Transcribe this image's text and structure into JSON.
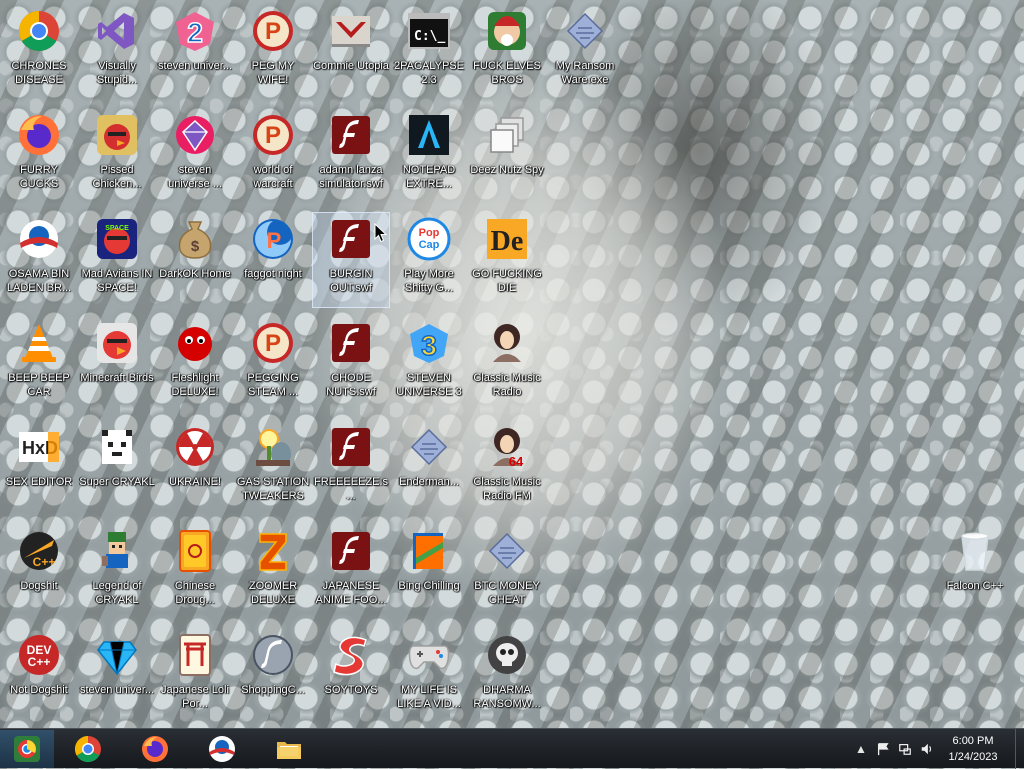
{
  "desktop": {
    "icons": [
      {
        "label": "CHRONES DISEASE",
        "icon": "chrome-icon"
      },
      {
        "label": "Visually Stupid...",
        "icon": "visual-studio-icon"
      },
      {
        "label": "steven univer...",
        "icon": "steven-universe-2-icon"
      },
      {
        "label": "PEG MY WIFE!",
        "icon": "popcap-peggle-icon"
      },
      {
        "label": "Commie Utopia",
        "icon": "papers-please-icon"
      },
      {
        "label": "2PACALYPSE 2.3",
        "icon": "command-prompt-icon"
      },
      {
        "label": "FUCK ELVES BROS",
        "icon": "elf-bros-icon"
      },
      {
        "label": "My Ransom Ware.exe",
        "icon": "diamond-executable-icon"
      },
      {
        "label": "FURRY CUCKS",
        "icon": "firefox-icon"
      },
      {
        "label": "Pissed Chicken...",
        "icon": "angry-birds-seasons-icon"
      },
      {
        "label": "steven universe ...",
        "icon": "steven-universe-gem-icon"
      },
      {
        "label": "world of warcraft",
        "icon": "popcap-peggle-icon"
      },
      {
        "label": "adamn lanza simulator.swf",
        "icon": "flash-file-icon"
      },
      {
        "label": "NOTEPAD EXTRE...",
        "icon": "notepad-extreme-icon"
      },
      {
        "label": "Deez Nutz Spy",
        "icon": "stacked-windows-icon"
      },
      {
        "label": "OSAMA BIN LADEN BR...",
        "icon": "obama-logo-icon"
      },
      {
        "label": "Mad Avians IN SPACE!",
        "icon": "angry-birds-space-icon"
      },
      {
        "label": "DarkOK Home",
        "icon": "money-bag-icon"
      },
      {
        "label": "faggot night",
        "icon": "popcap-peggle-nights-icon"
      },
      {
        "label": "BURGIN OUT.swf",
        "icon": "flash-file-icon"
      },
      {
        "label": "Play More Shitty G...",
        "icon": "popcap-icon"
      },
      {
        "label": "GO FUCKING DIE",
        "icon": "de-logo-icon"
      },
      {
        "label": "BEEP BEEP CAR",
        "icon": "vlc-icon"
      },
      {
        "label": "Minecraft Birds",
        "icon": "angry-birds-icon"
      },
      {
        "label": "Fleshlight DELUXE!",
        "icon": "red-fuzzball-icon"
      },
      {
        "label": "PEGGING STEAM ...",
        "icon": "popcap-peggle-icon"
      },
      {
        "label": "CHODE NUTS.swf",
        "icon": "flash-file-icon"
      },
      {
        "label": "STEVEN UNIVERSE 3",
        "icon": "steven-universe-3-icon"
      },
      {
        "label": "Classic Music Radio",
        "icon": "classic-portrait-icon"
      },
      {
        "label": "SEX EDITOR",
        "icon": "hxd-hex-editor-icon"
      },
      {
        "label": "Super CRYAKL",
        "icon": "pixel-cat-icon"
      },
      {
        "label": "UKRAINE!",
        "icon": "radiation-icon"
      },
      {
        "label": "GAS STATION TWEAKERS",
        "icon": "plants-vs-zombies-icon"
      },
      {
        "label": "FREEEEEZE.s...",
        "icon": "flash-file-icon"
      },
      {
        "label": "Enderman...",
        "icon": "diamond-executable-icon"
      },
      {
        "label": "Classic Music Radio FM",
        "icon": "classic-portrait-64-icon"
      },
      {
        "label": "Dogshit",
        "icon": "code-blocks-icon"
      },
      {
        "label": "Legend of CRYAKL",
        "icon": "pixel-hero-icon"
      },
      {
        "label": "Chinese Droug...",
        "icon": "mahjong-tile-icon"
      },
      {
        "label": "ZOOMER DELUXE",
        "icon": "zuma-icon"
      },
      {
        "label": "JAPANESE ANIME FOO...",
        "icon": "flash-file-icon"
      },
      {
        "label": "Bing Chilling",
        "icon": "bookworm-icon"
      },
      {
        "label": "BTC MONEY CHEAT",
        "icon": "diamond-executable-icon"
      },
      {
        "label": "Not Dogshit",
        "icon": "dev-cpp-icon"
      },
      {
        "label": "steven univer...",
        "icon": "blue-diamond-icon"
      },
      {
        "label": "Japanese Loli Por...",
        "icon": "mahjong-torii-icon"
      },
      {
        "label": "ShoppingC...",
        "icon": "flash-player-icon"
      },
      {
        "label": "SOYTOYS",
        "icon": "red-s-logo-icon"
      },
      {
        "label": "MY LIFE IS LIKE A VID...",
        "icon": "gamepad-icon"
      },
      {
        "label": "DHARMA RANSOMW...",
        "icon": "skull-bomb-icon"
      },
      {
        "label": "Falcon C++",
        "icon": "recycle-bin-icon"
      }
    ],
    "selected_label": "BURGIN OUT.swf"
  },
  "taskbar": {
    "pinned": [
      {
        "name": "start-button",
        "icon": "start-orb-icon"
      },
      {
        "name": "taskbar-chrome",
        "icon": "chrome-icon"
      },
      {
        "name": "taskbar-firefox",
        "icon": "firefox-icon"
      },
      {
        "name": "taskbar-obama",
        "icon": "obama-logo-icon"
      },
      {
        "name": "taskbar-explorer",
        "icon": "folder-icon"
      }
    ],
    "tray_icons": [
      "chevron-up-icon",
      "flag-icon",
      "network-icon",
      "volume-icon"
    ],
    "clock": {
      "time": "6:00 PM",
      "date": "1/24/2023"
    }
  },
  "colors": {
    "flash_red": "#7a1214",
    "taskbar": "#1c2024",
    "label_text": "#ffffff"
  }
}
